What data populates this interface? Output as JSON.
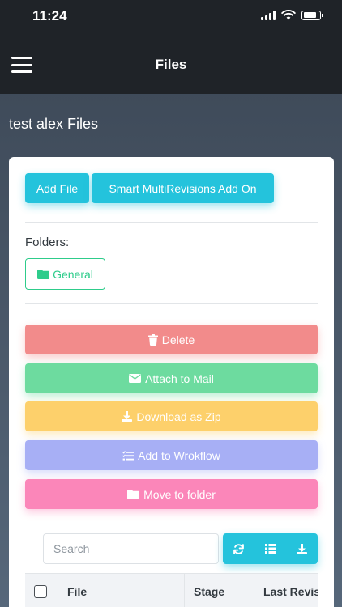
{
  "status_bar": {
    "time": "11:24",
    "battery_level": 0.8,
    "icons": [
      "signal-icon",
      "wifi-icon",
      "battery-icon"
    ]
  },
  "header": {
    "title": "Files",
    "menu_icon": "hamburger-icon"
  },
  "page": {
    "heading": "test alex Files"
  },
  "top_buttons": {
    "add_file": "Add File",
    "smart_revisions": "Smart MultiRevisions Add On"
  },
  "folders": {
    "label": "Folders:",
    "items": [
      {
        "label": "General",
        "icon": "folder-icon"
      }
    ]
  },
  "actions": [
    {
      "key": "delete",
      "label": "Delete",
      "icon": "trash-icon",
      "color": "#f28b8b"
    },
    {
      "key": "attach",
      "label": "Attach to Mail",
      "icon": "envelope-icon",
      "color": "#6ddb9f"
    },
    {
      "key": "zip",
      "label": "Download as Zip",
      "icon": "download-icon",
      "color": "#fdd06b"
    },
    {
      "key": "workflow",
      "label": "Add to Wrokflow",
      "icon": "list-check-icon",
      "color": "#a7aff5"
    },
    {
      "key": "move",
      "label": "Move to folder",
      "icon": "folder-icon",
      "color": "#fb86b9"
    }
  ],
  "search": {
    "placeholder": "Search",
    "value": ""
  },
  "toolbar": {
    "icons": [
      "refresh-icon",
      "list-icon",
      "download-icon"
    ]
  },
  "table": {
    "columns": [
      "File",
      "Stage",
      "Last Revis"
    ]
  },
  "colors": {
    "accent": "#24c3dc",
    "folder_green": "#2ecc8b",
    "header_bg": "#1f2328"
  }
}
